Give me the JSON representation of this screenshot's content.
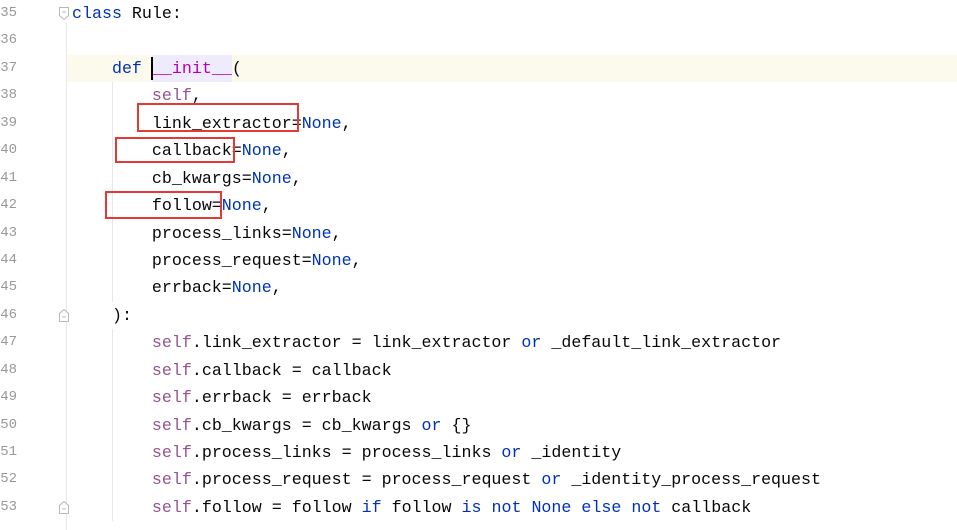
{
  "theme": {
    "keyword": "#0033b3",
    "magic_method": "#b200b2",
    "self": "#94558d",
    "text": "#080808",
    "line_number": "#999999",
    "current_line_bg": "#fcfaed",
    "identifier_highlight_bg": "#edebfc",
    "indent_guide": "#e8e8e8",
    "fold_icon": "#b8b8b8",
    "annotation": "#e53935"
  },
  "editor": {
    "current_line": 37,
    "lines": [
      {
        "num": "35",
        "fold_icon": "fold-start-icon",
        "tokens": [
          {
            "kw": "class"
          },
          {
            "text": " Rule:"
          }
        ]
      },
      {
        "num": "36",
        "tokens": []
      },
      {
        "num": "37",
        "tokens": [
          {
            "ws": "    "
          },
          {
            "kw": "def"
          },
          {
            "ws": " "
          },
          {
            "magic": "__init__",
            "highlight": true,
            "caret": true
          },
          {
            "text": "("
          }
        ]
      },
      {
        "num": "38",
        "tokens": [
          {
            "ws": "        "
          },
          {
            "self": "self"
          },
          {
            "text": ","
          }
        ]
      },
      {
        "num": "39",
        "tokens": [
          {
            "ws": "        "
          },
          {
            "text": "link_extractor="
          },
          {
            "kw": "None"
          },
          {
            "text": ","
          }
        ]
      },
      {
        "num": "40",
        "tokens": [
          {
            "ws": "        "
          },
          {
            "text": "callback="
          },
          {
            "kw": "None"
          },
          {
            "text": ","
          }
        ]
      },
      {
        "num": "41",
        "tokens": [
          {
            "ws": "        "
          },
          {
            "text": "cb_kwargs="
          },
          {
            "kw": "None"
          },
          {
            "text": ","
          }
        ]
      },
      {
        "num": "42",
        "tokens": [
          {
            "ws": "        "
          },
          {
            "text": "follow="
          },
          {
            "kw": "None"
          },
          {
            "text": ","
          }
        ]
      },
      {
        "num": "43",
        "tokens": [
          {
            "ws": "        "
          },
          {
            "text": "process_links="
          },
          {
            "kw": "None"
          },
          {
            "text": ","
          }
        ]
      },
      {
        "num": "44",
        "tokens": [
          {
            "ws": "        "
          },
          {
            "text": "process_request="
          },
          {
            "kw": "None"
          },
          {
            "text": ","
          }
        ]
      },
      {
        "num": "45",
        "tokens": [
          {
            "ws": "        "
          },
          {
            "text": "errback="
          },
          {
            "kw": "None"
          },
          {
            "text": ","
          }
        ]
      },
      {
        "num": "46",
        "fold_icon": "fold-end-icon",
        "tokens": [
          {
            "ws": "    "
          },
          {
            "text": "):"
          }
        ]
      },
      {
        "num": "47",
        "tokens": [
          {
            "ws": "        "
          },
          {
            "self": "self"
          },
          {
            "text": ".link_extractor = link_extractor "
          },
          {
            "kw": "or"
          },
          {
            "text": " _default_link_extractor"
          }
        ]
      },
      {
        "num": "48",
        "tokens": [
          {
            "ws": "        "
          },
          {
            "self": "self"
          },
          {
            "text": ".callback = callback"
          }
        ]
      },
      {
        "num": "49",
        "tokens": [
          {
            "ws": "        "
          },
          {
            "self": "self"
          },
          {
            "text": ".errback = errback"
          }
        ]
      },
      {
        "num": "50",
        "tokens": [
          {
            "ws": "        "
          },
          {
            "self": "self"
          },
          {
            "text": ".cb_kwargs = cb_kwargs "
          },
          {
            "kw": "or"
          },
          {
            "text": " {}"
          }
        ]
      },
      {
        "num": "51",
        "tokens": [
          {
            "ws": "        "
          },
          {
            "self": "self"
          },
          {
            "text": ".process_links = process_links "
          },
          {
            "kw": "or"
          },
          {
            "text": " _identity"
          }
        ]
      },
      {
        "num": "52",
        "tokens": [
          {
            "ws": "        "
          },
          {
            "self": "self"
          },
          {
            "text": ".process_request = process_request "
          },
          {
            "kw": "or"
          },
          {
            "text": " _identity_process_request"
          }
        ]
      },
      {
        "num": "53",
        "fold_icon": "fold-end-icon",
        "tokens": [
          {
            "ws": "        "
          },
          {
            "self": "self"
          },
          {
            "text": ".follow = follow "
          },
          {
            "kw": "if"
          },
          {
            "text": " follow "
          },
          {
            "kw": "is"
          },
          {
            "ws": " "
          },
          {
            "kw": "not"
          },
          {
            "ws": " "
          },
          {
            "kw": "None"
          },
          {
            "ws": " "
          },
          {
            "kw": "else"
          },
          {
            "ws": " "
          },
          {
            "kw": "not"
          },
          {
            "text": " callback"
          }
        ]
      }
    ]
  }
}
